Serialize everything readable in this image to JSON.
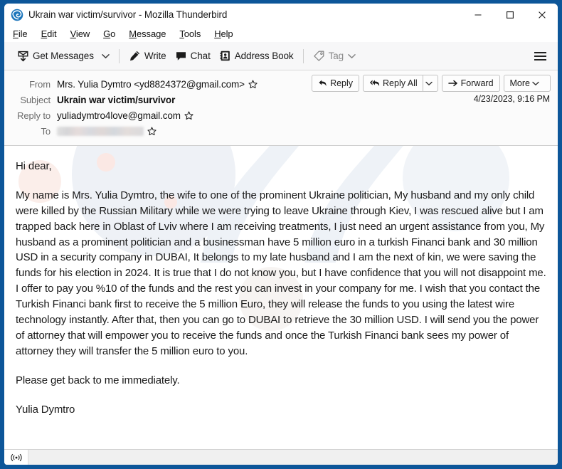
{
  "window": {
    "title": "Ukrain war victim/survivor - Mozilla Thunderbird",
    "app_icon": "thunderbird-logo-icon",
    "controls": {
      "minimize": "minimize-icon",
      "maximize": "maximize-icon",
      "close": "close-icon"
    },
    "accent_color": "#0d5699"
  },
  "menubar": {
    "items": [
      {
        "label": "File",
        "accesskey": "F"
      },
      {
        "label": "Edit",
        "accesskey": "E"
      },
      {
        "label": "View",
        "accesskey": "V"
      },
      {
        "label": "Go",
        "accesskey": "G"
      },
      {
        "label": "Message",
        "accesskey": "M"
      },
      {
        "label": "Tools",
        "accesskey": "T"
      },
      {
        "label": "Help",
        "accesskey": "H"
      }
    ]
  },
  "toolbar": {
    "get_messages": "Get Messages",
    "write": "Write",
    "chat": "Chat",
    "address_book": "Address Book",
    "tag": "Tag",
    "menu_button": "app-menu-icon"
  },
  "message_header": {
    "from_label": "From",
    "from_value": "Mrs. Yulia Dymtro <yd8824372@gmail.com>",
    "subject_label": "Subject",
    "subject_value": "Ukrain war victim/survivor",
    "reply_to_label": "Reply to",
    "reply_to_value": "yuliadymtro4love@gmail.com",
    "to_label": "To",
    "to_value": "",
    "to_redacted": true,
    "date": "4/23/2023, 9:16 PM",
    "actions": {
      "reply": "Reply",
      "reply_all": "Reply All",
      "forward": "Forward",
      "more": "More"
    }
  },
  "body": {
    "greeting": "Hi dear,",
    "paragraph_1": "My name is Mrs. Yulia Dymtro, the wife to one of the prominent Ukraine politician, My husband and my only child were killed by the Russian Military while we were trying to leave Ukraine through Kiev, I was rescued alive but I am trapped back here in Oblast of Lviv where I am receiving treatments, I just need an urgent assistance from you, My husband as a prominent politician and a businessman have 5 million euro in a turkish Financi bank and 30 million USD in a security company in DUBAI, It belongs to my late husband and I am the next of kin, we were saving the funds for his election in 2024. It is true that I do not know you, but I have confidence that you will not disappoint me. I offer to pay you %10 of the funds and the rest you can invest in your company for me. I wish that you contact the Turkish Financi bank first to receive the 5 million Euro, they will release the funds to you using the latest wire technology instantly. After that, then you can go to DUBAI to retrieve the 30 million USD. I will send you the power of attorney that will empower you to receive the funds and once the Turkish Financi bank sees my power of attorney they will transfer the 5 million euro to you.",
    "paragraph_2": "Please get back to me immediately.",
    "signature": "Yulia Dymtro"
  },
  "statusbar": {
    "icon": "broadcast-icon",
    "text": ""
  }
}
